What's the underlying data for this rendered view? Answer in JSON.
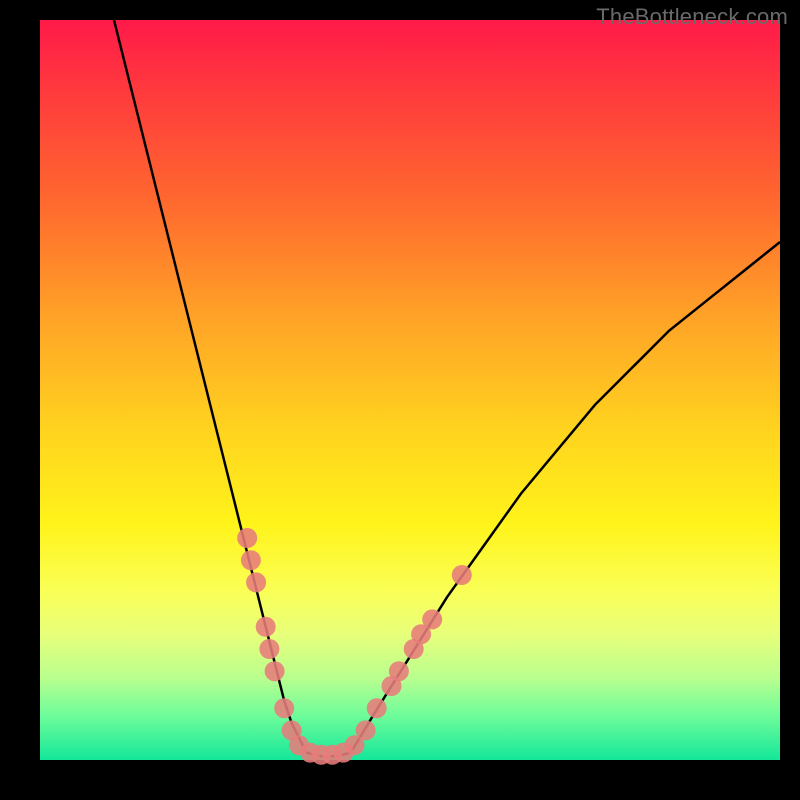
{
  "watermark": "TheBottleneck.com",
  "chart_data": {
    "type": "line",
    "title": "",
    "xlabel": "",
    "ylabel": "",
    "xlim": [
      0,
      100
    ],
    "ylim": [
      0,
      100
    ],
    "grid": false,
    "legend": false,
    "background_gradient": [
      "#ff1a49",
      "#fff31a",
      "#14e79a"
    ],
    "series": [
      {
        "name": "left-curve",
        "color": "#000000",
        "x": [
          10,
          12,
          14,
          16,
          18,
          20,
          22,
          24,
          26,
          28,
          30,
          32,
          33,
          34,
          35,
          36
        ],
        "y": [
          100,
          92,
          84,
          76,
          68,
          60,
          52,
          44,
          36,
          28,
          20,
          12,
          8,
          5,
          3,
          1
        ]
      },
      {
        "name": "flat-bottom",
        "color": "#000000",
        "x": [
          36,
          38,
          40,
          42
        ],
        "y": [
          1,
          0.5,
          0.5,
          1
        ]
      },
      {
        "name": "right-curve",
        "color": "#000000",
        "x": [
          42,
          45,
          50,
          55,
          60,
          65,
          70,
          75,
          80,
          85,
          90,
          95,
          100
        ],
        "y": [
          1,
          6,
          14,
          22,
          29,
          36,
          42,
          48,
          53,
          58,
          62,
          66,
          70
        ]
      }
    ],
    "markers": {
      "color": "#e77c7b",
      "radius": 10,
      "points": [
        {
          "x": 28.0,
          "y": 30
        },
        {
          "x": 28.5,
          "y": 27
        },
        {
          "x": 29.2,
          "y": 24
        },
        {
          "x": 30.5,
          "y": 18
        },
        {
          "x": 31.0,
          "y": 15
        },
        {
          "x": 31.7,
          "y": 12
        },
        {
          "x": 33.0,
          "y": 7
        },
        {
          "x": 34.0,
          "y": 4
        },
        {
          "x": 35.0,
          "y": 2
        },
        {
          "x": 36.5,
          "y": 1
        },
        {
          "x": 38.0,
          "y": 0.7
        },
        {
          "x": 39.5,
          "y": 0.7
        },
        {
          "x": 41.0,
          "y": 1
        },
        {
          "x": 42.5,
          "y": 2
        },
        {
          "x": 44.0,
          "y": 4
        },
        {
          "x": 45.5,
          "y": 7
        },
        {
          "x": 47.5,
          "y": 10
        },
        {
          "x": 48.5,
          "y": 12
        },
        {
          "x": 50.5,
          "y": 15
        },
        {
          "x": 51.5,
          "y": 17
        },
        {
          "x": 53.0,
          "y": 19
        },
        {
          "x": 57.0,
          "y": 25
        }
      ]
    }
  }
}
